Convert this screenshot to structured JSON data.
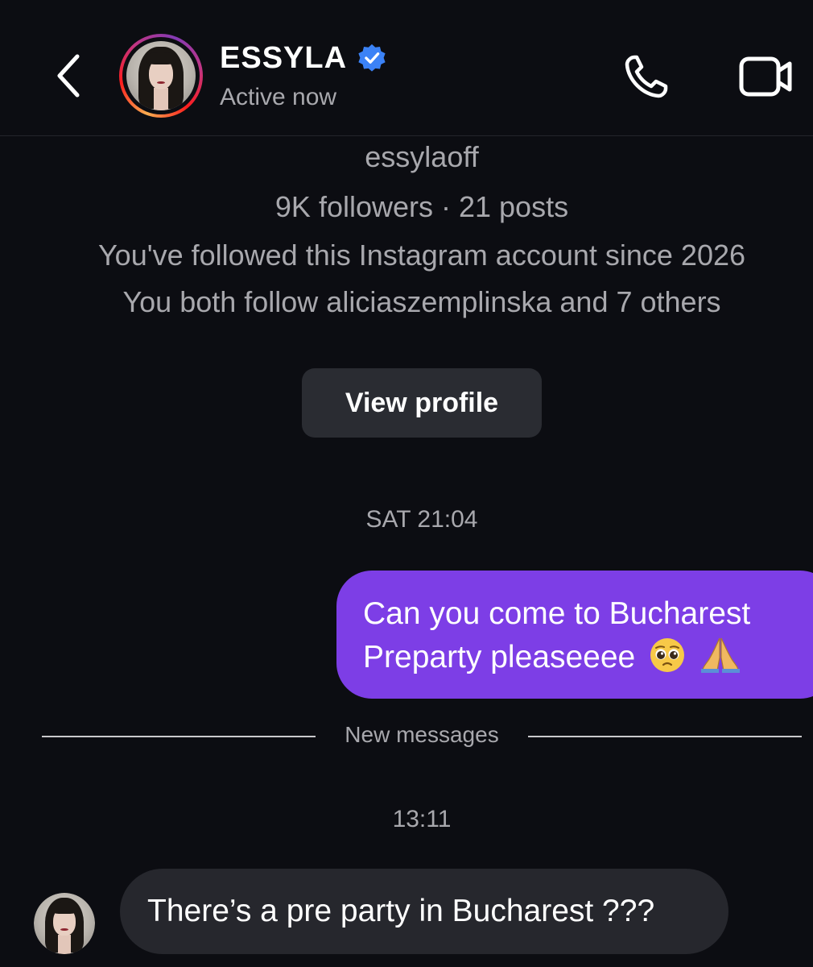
{
  "header": {
    "display_name": "ESSYLA",
    "verified": true,
    "status": "Active now",
    "accent_color": "#3b82f6"
  },
  "profile": {
    "username": "essylaoff",
    "stats": "9K followers · 21 posts",
    "follow_since": "You've followed this Instagram account since 2026",
    "mutual_follows": "You both follow aliciaszemplinska and 7 others",
    "view_profile_label": "View profile"
  },
  "messages": {
    "timestamp_1": "SAT 21:04",
    "sent": {
      "line1": "Can you come to Bucharest",
      "line2": "Preparty pleaseeee",
      "emojis": [
        "pleading-face-icon",
        "folded-hands-icon"
      ],
      "bubble_color": "#7d3ee6"
    },
    "new_messages_label": "New messages",
    "timestamp_2": "13:11",
    "received": {
      "text": "There’s a pre party in Bucharest ???",
      "bubble_color": "#26272d"
    }
  }
}
